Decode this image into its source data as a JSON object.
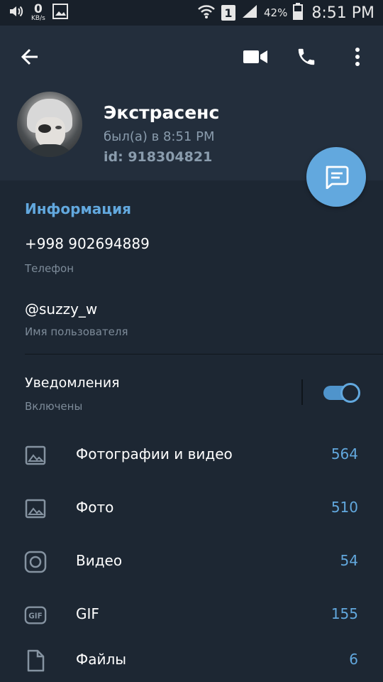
{
  "status_bar": {
    "speed_value": "0",
    "speed_unit": "KB/s",
    "sim_slot": "1",
    "battery_percent": "42%",
    "time": "8:51 PM"
  },
  "profile": {
    "name": "Экстрасенс",
    "last_seen": "был(а) в 8:51 PM",
    "id": "id: 918304821"
  },
  "info": {
    "title": "Информация",
    "phone_value": "+998 902694889",
    "phone_label": "Телефон",
    "username_value": "@suzzy_w",
    "username_label": "Имя пользователя"
  },
  "notifications": {
    "title": "Уведомления",
    "status": "Включены",
    "enabled": true
  },
  "media": [
    {
      "icon": "image-icon",
      "label": "Фотографии и видео",
      "count": "564"
    },
    {
      "icon": "image-icon",
      "label": "Фото",
      "count": "510"
    },
    {
      "icon": "video-circle-icon",
      "label": "Видео",
      "count": "54"
    },
    {
      "icon": "gif-icon",
      "label": "GIF",
      "count": "155"
    },
    {
      "icon": "file-icon",
      "label": "Файлы",
      "count": "6"
    }
  ],
  "colors": {
    "background": "#1d2733",
    "header": "#232e3c",
    "accent": "#62a8de",
    "secondary_text": "#7d8b99"
  }
}
